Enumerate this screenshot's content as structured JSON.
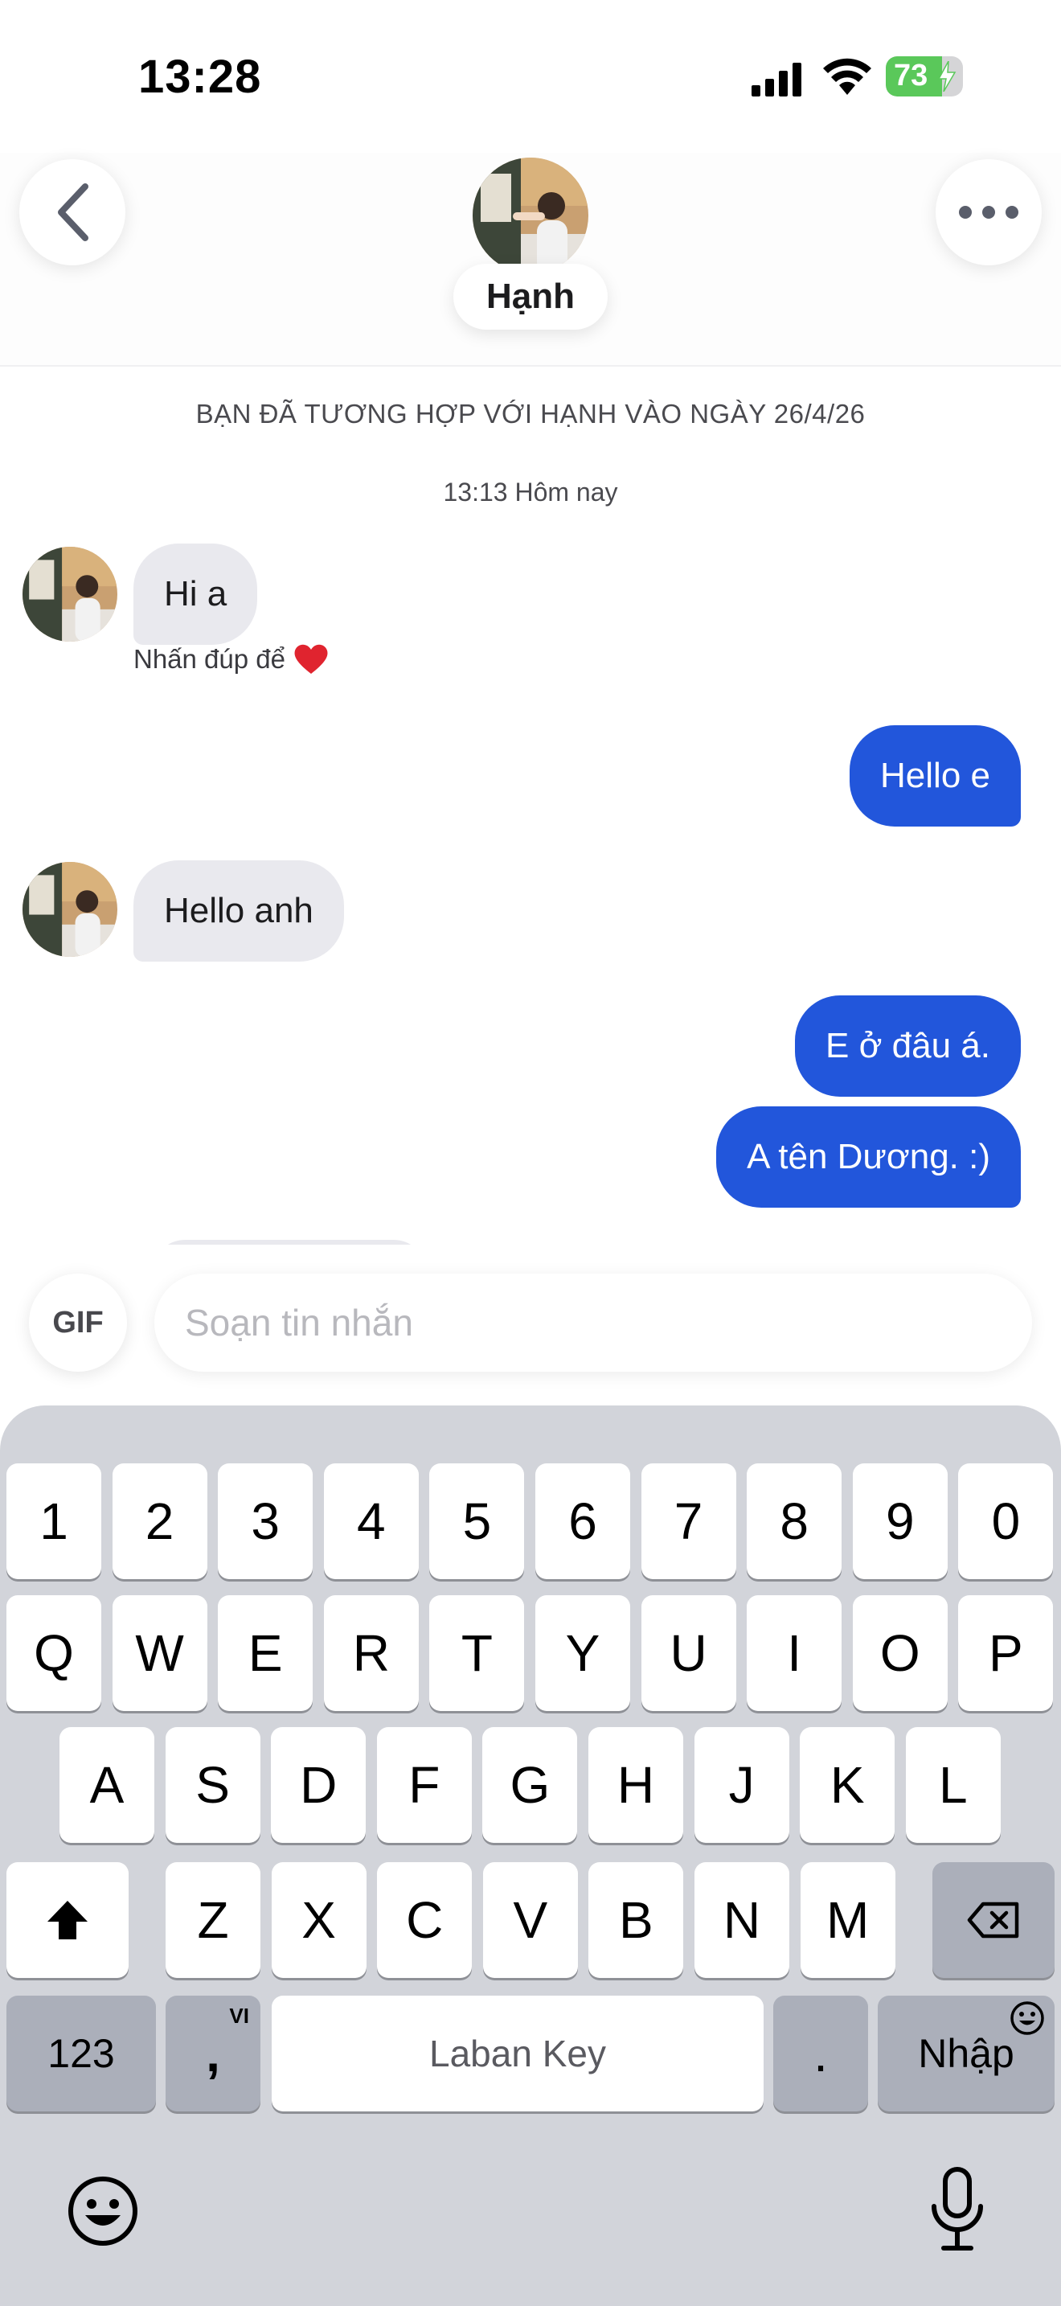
{
  "status_bar": {
    "time": "13:28",
    "battery_level": "73",
    "battery_fill_percent": 73,
    "icons": [
      "cellular-signal-icon",
      "wifi-icon",
      "battery-charging-icon"
    ]
  },
  "header": {
    "contact_name": "Hạnh",
    "back_icon": "chevron-left-icon",
    "more_icon": "ellipsis-icon"
  },
  "chat": {
    "match_banner": "BẠN ĐÃ TƯƠNG HỢP VỚI HẠNH VÀO NGÀY 26/4/26",
    "timestamp": "13:13 Hôm nay",
    "double_tap_hint": "Nhấn đúp để",
    "double_tap_hint_icon": "heart-icon",
    "messages": [
      {
        "direction": "in",
        "text": "Hi a"
      },
      {
        "direction": "out",
        "text": "Hello e"
      },
      {
        "direction": "in",
        "text": "Hello anh"
      },
      {
        "direction": "out",
        "text": "E ở đâu á."
      },
      {
        "direction": "out",
        "text": "A tên Dương. :)"
      }
    ]
  },
  "composer": {
    "gif_label": "GIF",
    "placeholder": "Soạn tin nhắn",
    "value": ""
  },
  "keyboard": {
    "number_row": [
      "1",
      "2",
      "3",
      "4",
      "5",
      "6",
      "7",
      "8",
      "9",
      "0"
    ],
    "row1": [
      "Q",
      "W",
      "E",
      "R",
      "T",
      "Y",
      "U",
      "I",
      "O",
      "P"
    ],
    "row2": [
      "A",
      "S",
      "D",
      "F",
      "G",
      "H",
      "J",
      "K",
      "L"
    ],
    "row3": [
      "Z",
      "X",
      "C",
      "V",
      "B",
      "N",
      "M"
    ],
    "numbers_key": "123",
    "comma_key": ",",
    "comma_sub": "VI",
    "space_label": "Laban Key",
    "period_key": ".",
    "return_label": "Nhập",
    "shift_icon": "shift-icon",
    "delete_icon": "backspace-icon",
    "emoji_icon": "emoji-icon",
    "mic_icon": "microphone-icon",
    "colors": {
      "background": "#d2d4da",
      "key": "#ffffff",
      "key_dark": "#abafba"
    }
  },
  "colors": {
    "outgoing_bubble": "#2256db",
    "incoming_bubble": "#e9e9ee",
    "battery_green": "#5ac85a"
  }
}
